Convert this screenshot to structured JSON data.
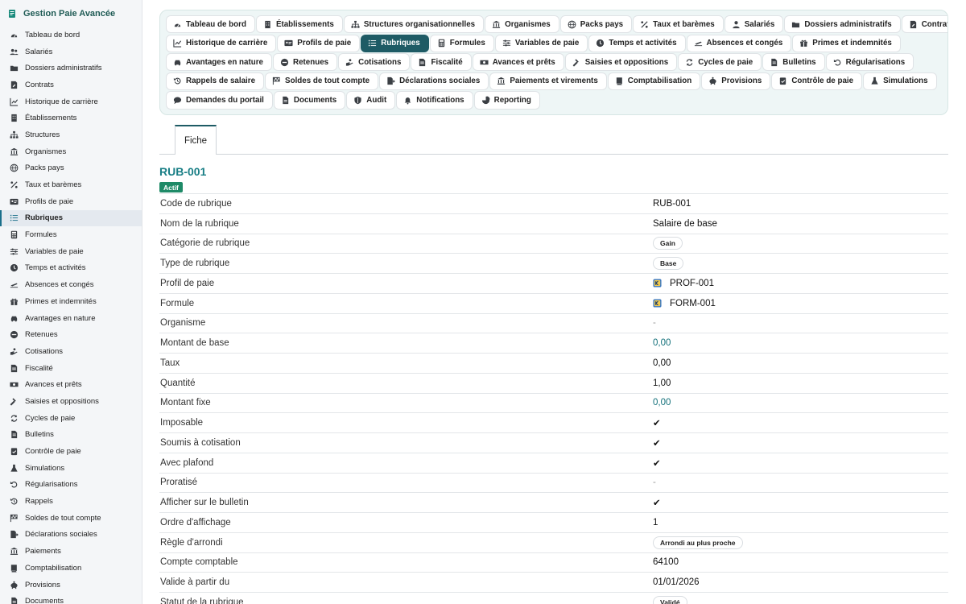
{
  "app": {
    "title": "Gestion Paie Avancée"
  },
  "sidebar": {
    "items": [
      {
        "label": "Tableau de bord",
        "icon": "gauge-icon"
      },
      {
        "label": "Salariés",
        "icon": "users-icon"
      },
      {
        "label": "Dossiers administratifs",
        "icon": "folder-open-icon"
      },
      {
        "label": "Contrats",
        "icon": "contract-icon"
      },
      {
        "label": "Historique de carrière",
        "icon": "chart-line-icon"
      },
      {
        "label": "Établissements",
        "icon": "building-icon"
      },
      {
        "label": "Structures",
        "icon": "sitemap-icon"
      },
      {
        "label": "Organismes",
        "icon": "landmark-icon"
      },
      {
        "label": "Packs pays",
        "icon": "globe-icon"
      },
      {
        "label": "Taux et barèmes",
        "icon": "percent-icon"
      },
      {
        "label": "Profils de paie",
        "icon": "id-card-icon"
      },
      {
        "label": "Rubriques",
        "icon": "list-icon",
        "active": true
      },
      {
        "label": "Formules",
        "icon": "calculator-icon"
      },
      {
        "label": "Variables de paie",
        "icon": "sliders-icon"
      },
      {
        "label": "Temps et activités",
        "icon": "clock-icon"
      },
      {
        "label": "Absences et congés",
        "icon": "plane-icon"
      },
      {
        "label": "Primes et indemnités",
        "icon": "gift-icon"
      },
      {
        "label": "Avantages en nature",
        "icon": "car-icon"
      },
      {
        "label": "Retenues",
        "icon": "minus-circle-icon"
      },
      {
        "label": "Cotisations",
        "icon": "hand-coins-icon"
      },
      {
        "label": "Fiscalité",
        "icon": "file-invoice-icon"
      },
      {
        "label": "Avances et prêts",
        "icon": "money-bill-icon"
      },
      {
        "label": "Saisies et oppositions",
        "icon": "gavel-icon"
      },
      {
        "label": "Cycles de paie",
        "icon": "sync-icon"
      },
      {
        "label": "Bulletins",
        "icon": "file-alt-icon"
      },
      {
        "label": "Contrôle de paie",
        "icon": "clipboard-check-icon"
      },
      {
        "label": "Simulations",
        "icon": "flask-icon"
      },
      {
        "label": "Régularisations",
        "icon": "undo-icon"
      },
      {
        "label": "Rappels",
        "icon": "history-icon"
      },
      {
        "label": "Soldes de tout compte",
        "icon": "flag-checkered-icon"
      },
      {
        "label": "Déclarations sociales",
        "icon": "file-export-icon"
      },
      {
        "label": "Paiements",
        "icon": "bank-icon"
      },
      {
        "label": "Comptabilisation",
        "icon": "book-icon"
      },
      {
        "label": "Provisions",
        "icon": "piggy-bank-icon"
      },
      {
        "label": "Documents",
        "icon": "document-icon"
      }
    ]
  },
  "tabs": {
    "rows": [
      [
        {
          "label": "Tableau de bord",
          "icon": "gauge-icon"
        },
        {
          "label": "Établissements",
          "icon": "building-icon"
        },
        {
          "label": "Structures organisationnelles",
          "icon": "sitemap-icon"
        },
        {
          "label": "Organismes",
          "icon": "landmark-icon"
        },
        {
          "label": "Packs pays",
          "icon": "globe-icon"
        },
        {
          "label": "Taux et barèmes",
          "icon": "percent-icon"
        },
        {
          "label": "Salariés",
          "icon": "user-icon"
        },
        {
          "label": "Dossiers administratifs",
          "icon": "folder-open-icon"
        },
        {
          "label": "Contrats",
          "icon": "contract-icon"
        }
      ],
      [
        {
          "label": "Historique de carrière",
          "icon": "chart-line-icon"
        },
        {
          "label": "Profils de paie",
          "icon": "id-card-icon"
        },
        {
          "label": "Rubriques",
          "icon": "list-icon",
          "active": true
        },
        {
          "label": "Formules",
          "icon": "calculator-icon"
        },
        {
          "label": "Variables de paie",
          "icon": "sliders-icon"
        },
        {
          "label": "Temps et activités",
          "icon": "clock-icon"
        },
        {
          "label": "Absences et congés",
          "icon": "plane-icon"
        },
        {
          "label": "Primes et indemnités",
          "icon": "gift-icon"
        }
      ],
      [
        {
          "label": "Avantages en nature",
          "icon": "car-icon"
        },
        {
          "label": "Retenues",
          "icon": "minus-circle-icon"
        },
        {
          "label": "Cotisations",
          "icon": "hand-coins-icon"
        },
        {
          "label": "Fiscalité",
          "icon": "file-invoice-icon"
        },
        {
          "label": "Avances et prêts",
          "icon": "money-bill-icon"
        },
        {
          "label": "Saisies et oppositions",
          "icon": "gavel-icon"
        },
        {
          "label": "Cycles de paie",
          "icon": "sync-icon"
        },
        {
          "label": "Bulletins",
          "icon": "file-alt-icon"
        },
        {
          "label": "Régularisations",
          "icon": "undo-icon"
        }
      ],
      [
        {
          "label": "Rappels de salaire",
          "icon": "history-icon"
        },
        {
          "label": "Soldes de tout compte",
          "icon": "flag-checkered-icon"
        },
        {
          "label": "Déclarations sociales",
          "icon": "file-export-icon"
        },
        {
          "label": "Paiements et virements",
          "icon": "bank-icon"
        },
        {
          "label": "Comptabilisation",
          "icon": "book-icon"
        },
        {
          "label": "Provisions",
          "icon": "piggy-bank-icon"
        },
        {
          "label": "Contrôle de paie",
          "icon": "clipboard-check-icon"
        },
        {
          "label": "Simulations",
          "icon": "flask-icon"
        }
      ],
      [
        {
          "label": "Demandes du portail",
          "icon": "comment-icon"
        },
        {
          "label": "Documents",
          "icon": "document-icon"
        },
        {
          "label": "Audit",
          "icon": "shield-icon"
        },
        {
          "label": "Notifications",
          "icon": "bell-icon"
        },
        {
          "label": "Reporting",
          "icon": "pie-chart-icon"
        }
      ]
    ]
  },
  "subtabs": {
    "fiche": "Fiche"
  },
  "record": {
    "code": "RUB-001",
    "status": "Actif",
    "fields": [
      {
        "label": "Code de rubrique",
        "value": "RUB-001",
        "kind": "text"
      },
      {
        "label": "Nom de la rubrique",
        "value": "Salaire de base",
        "kind": "text"
      },
      {
        "label": "Catégorie de rubrique",
        "value": "Gain",
        "kind": "pill"
      },
      {
        "label": "Type de rubrique",
        "value": "Base",
        "kind": "pill"
      },
      {
        "label": "Profil de paie",
        "value": "PROF-001",
        "kind": "ref"
      },
      {
        "label": "Formule",
        "value": "FORM-001",
        "kind": "ref"
      },
      {
        "label": "Organisme",
        "value": "-",
        "kind": "muted"
      },
      {
        "label": "Montant de base",
        "value": "0,00",
        "kind": "link"
      },
      {
        "label": "Taux",
        "value": "0,00",
        "kind": "text"
      },
      {
        "label": "Quantité",
        "value": "1,00",
        "kind": "text"
      },
      {
        "label": "Montant fixe",
        "value": "0,00",
        "kind": "link"
      },
      {
        "label": "Imposable",
        "value": "✔",
        "kind": "check"
      },
      {
        "label": "Soumis à cotisation",
        "value": "✔",
        "kind": "check"
      },
      {
        "label": "Avec plafond",
        "value": "✔",
        "kind": "check"
      },
      {
        "label": "Proratisé",
        "value": "-",
        "kind": "muted"
      },
      {
        "label": "Afficher sur le bulletin",
        "value": "✔",
        "kind": "check"
      },
      {
        "label": "Ordre d'affichage",
        "value": "1",
        "kind": "text"
      },
      {
        "label": "Règle d'arrondi",
        "value": "Arrondi au plus proche",
        "kind": "pill"
      },
      {
        "label": "Compte comptable",
        "value": "64100",
        "kind": "text"
      },
      {
        "label": "Valide à partir du",
        "value": "01/01/2026",
        "kind": "text"
      },
      {
        "label": "Statut de la rubrique",
        "value": "Validé",
        "kind": "pill"
      }
    ]
  },
  "colors": {
    "accent": "#1e5b65",
    "title": "#1a7f86",
    "status_green": "#1e8a67",
    "check_green": "#2e8b37"
  }
}
